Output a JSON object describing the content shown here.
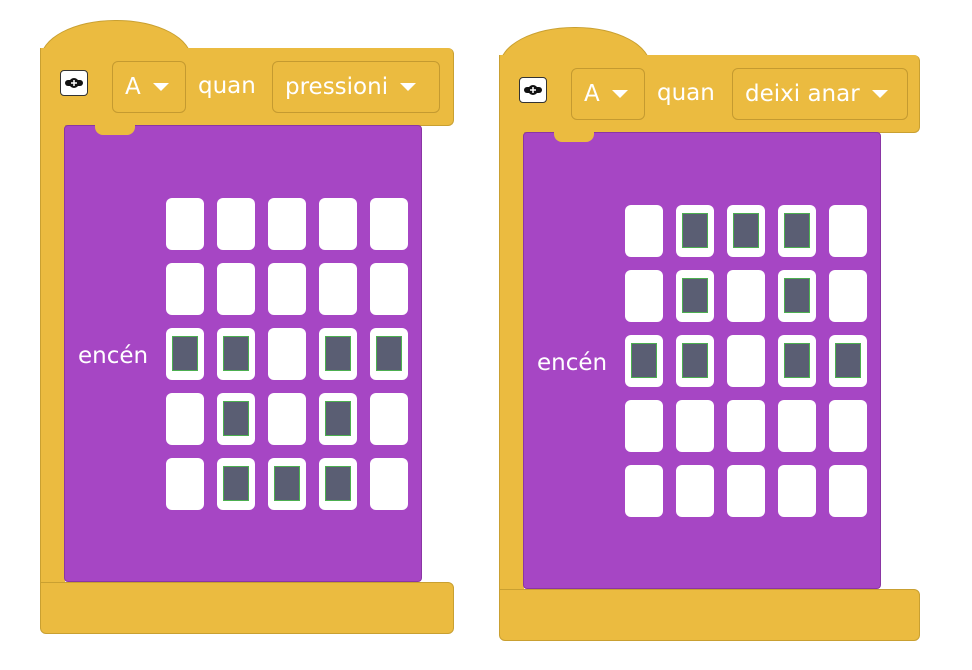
{
  "blocks": [
    {
      "button": "A",
      "label": "quan",
      "event": "pressioni",
      "action": "encén",
      "leds": [
        [
          0,
          0,
          0,
          0,
          0
        ],
        [
          0,
          0,
          0,
          0,
          0
        ],
        [
          1,
          1,
          0,
          1,
          1
        ],
        [
          0,
          1,
          0,
          1,
          0
        ],
        [
          0,
          1,
          1,
          1,
          0
        ]
      ]
    },
    {
      "button": "A",
      "label": "quan",
      "event": "deixi anar",
      "action": "encén",
      "leds": [
        [
          0,
          1,
          1,
          1,
          0
        ],
        [
          0,
          1,
          0,
          1,
          0
        ],
        [
          1,
          1,
          0,
          1,
          1
        ],
        [
          0,
          0,
          0,
          0,
          0
        ],
        [
          0,
          0,
          0,
          0,
          0
        ]
      ]
    }
  ],
  "colors": {
    "event": "#ebbb40",
    "display": "#a646c4",
    "led_on": "#5a5e73"
  }
}
